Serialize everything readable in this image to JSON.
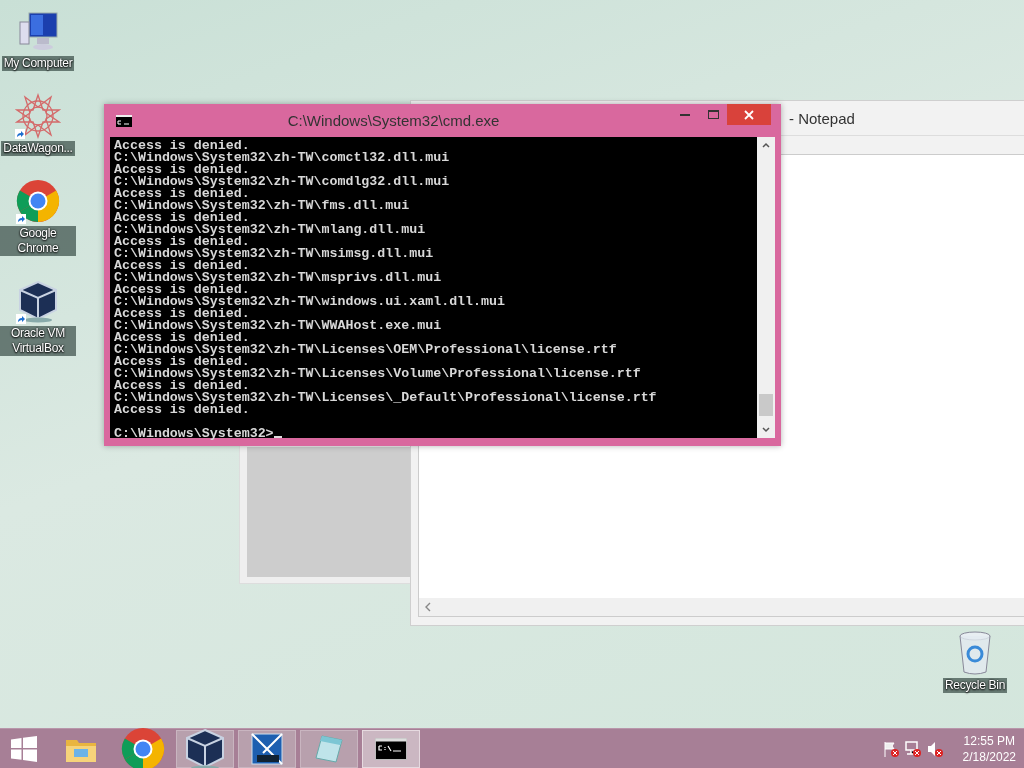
{
  "desktop_icons": [
    {
      "label": "My Computer",
      "kind": "computer",
      "shortcut": false
    },
    {
      "label": "DataWagon...",
      "kind": "star",
      "shortcut": true
    },
    {
      "label": "Google Chrome",
      "kind": "chrome",
      "shortcut": true
    },
    {
      "label": "Oracle VM VirtualBox",
      "kind": "cube",
      "shortcut": true
    }
  ],
  "recycle_bin": {
    "label": "Recycle Bin"
  },
  "notepad_window": {
    "title": "- Notepad"
  },
  "cmd_window": {
    "title": "C:\\Windows\\System32\\cmd.exe",
    "lines": [
      "Access is denied.",
      "C:\\Windows\\System32\\zh-TW\\comctl32.dll.mui",
      "Access is denied.",
      "C:\\Windows\\System32\\zh-TW\\comdlg32.dll.mui",
      "Access is denied.",
      "C:\\Windows\\System32\\zh-TW\\fms.dll.mui",
      "Access is denied.",
      "C:\\Windows\\System32\\zh-TW\\mlang.dll.mui",
      "Access is denied.",
      "C:\\Windows\\System32\\zh-TW\\msimsg.dll.mui",
      "Access is denied.",
      "C:\\Windows\\System32\\zh-TW\\msprivs.dll.mui",
      "Access is denied.",
      "C:\\Windows\\System32\\zh-TW\\windows.ui.xaml.dll.mui",
      "Access is denied.",
      "C:\\Windows\\System32\\zh-TW\\WWAHost.exe.mui",
      "Access is denied.",
      "C:\\Windows\\System32\\zh-TW\\Licenses\\OEM\\Professional\\license.rtf",
      "Access is denied.",
      "C:\\Windows\\System32\\zh-TW\\Licenses\\Volume\\Professional\\license.rtf",
      "Access is denied.",
      "C:\\Windows\\System32\\zh-TW\\Licenses\\_Default\\Professional\\license.rtf",
      "Access is denied."
    ],
    "prompt": "C:\\Windows\\System32>"
  },
  "taskbar": {
    "items": [
      {
        "kind": "start",
        "running": false,
        "selected": false
      },
      {
        "kind": "explorer",
        "running": false,
        "selected": false
      },
      {
        "kind": "chrome",
        "running": false,
        "selected": false
      },
      {
        "kind": "cube",
        "running": true,
        "selected": false
      },
      {
        "kind": "vista",
        "running": true,
        "selected": false
      },
      {
        "kind": "notepad",
        "running": true,
        "selected": false
      },
      {
        "kind": "console",
        "running": true,
        "selected": true
      }
    ],
    "time": "12:55 PM",
    "date": "2/18/2022"
  }
}
